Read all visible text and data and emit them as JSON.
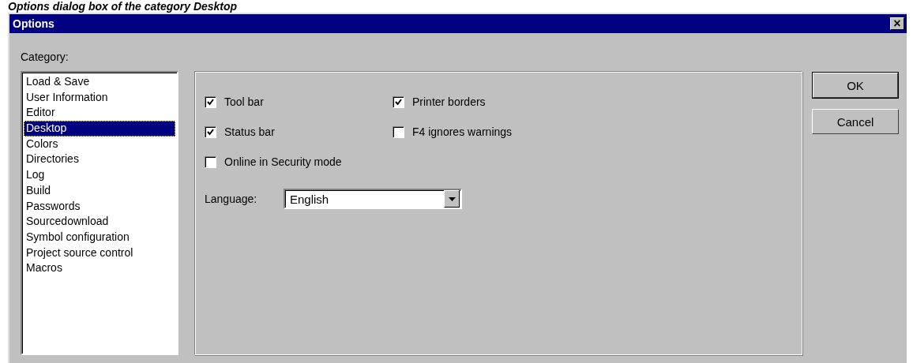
{
  "caption": "Options dialog box of the category Desktop",
  "window": {
    "title": "Options",
    "close": "×"
  },
  "category": {
    "label": "Category:",
    "items": [
      {
        "label": "Load & Save",
        "selected": false
      },
      {
        "label": "User Information",
        "selected": false
      },
      {
        "label": "Editor",
        "selected": false
      },
      {
        "label": "Desktop",
        "selected": true
      },
      {
        "label": "Colors",
        "selected": false
      },
      {
        "label": "Directories",
        "selected": false
      },
      {
        "label": "Log",
        "selected": false
      },
      {
        "label": "Build",
        "selected": false
      },
      {
        "label": "Passwords",
        "selected": false
      },
      {
        "label": "Sourcedownload",
        "selected": false
      },
      {
        "label": "Symbol configuration",
        "selected": false
      },
      {
        "label": "Project source control",
        "selected": false
      },
      {
        "label": "Macros",
        "selected": false
      }
    ]
  },
  "options": [
    {
      "label": "Tool bar",
      "checked": true
    },
    {
      "label": "Printer borders",
      "checked": true
    },
    {
      "label": "Status bar",
      "checked": true
    },
    {
      "label": "F4 ignores warnings",
      "checked": false
    },
    {
      "label": "Online in Security mode",
      "checked": false
    }
  ],
  "language": {
    "label": "Language:",
    "value": "English"
  },
  "buttons": [
    {
      "label": "OK",
      "default": true
    },
    {
      "label": "Cancel",
      "default": false
    }
  ]
}
